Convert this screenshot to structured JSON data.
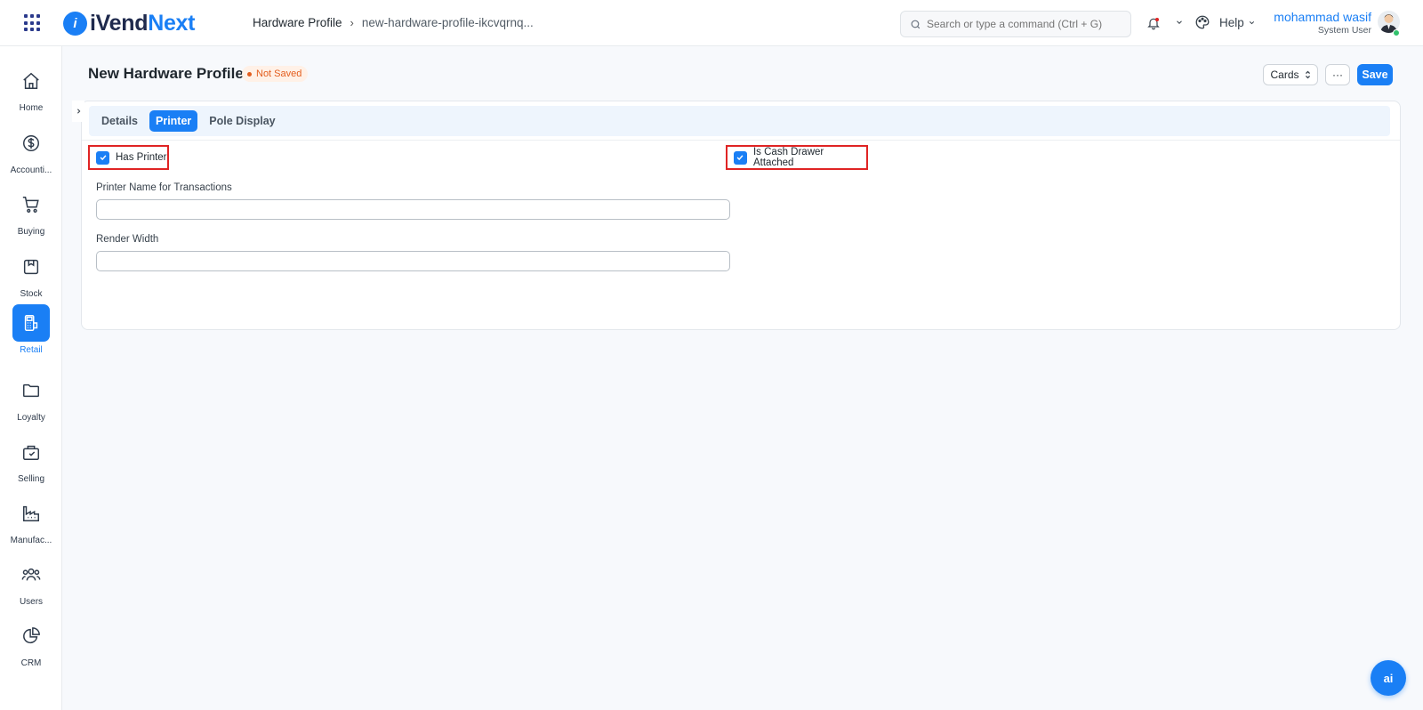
{
  "app": {
    "logo_prefix": "iVend",
    "logo_suffix": "Next"
  },
  "breadcrumb": {
    "parent": "Hardware Profile",
    "separator": "›",
    "current": "new-hardware-profile-ikcvqrnq..."
  },
  "search": {
    "placeholder": "Search or type a command (Ctrl + G)"
  },
  "header": {
    "help_label": "Help"
  },
  "user": {
    "name": "mohammad wasif",
    "role": "System User"
  },
  "sidebar": {
    "items": [
      {
        "label": "Home",
        "icon": "home-icon"
      },
      {
        "label": "Accounti...",
        "icon": "dollar-icon"
      },
      {
        "label": "Buying",
        "icon": "cart-icon"
      },
      {
        "label": "Stock",
        "icon": "box-icon"
      },
      {
        "label": "Retail",
        "icon": "pos-icon"
      },
      {
        "label": "Loyalty",
        "icon": "folder-icon"
      },
      {
        "label": "Selling",
        "icon": "shopping-bag-icon"
      },
      {
        "label": "Manufac...",
        "icon": "factory-icon"
      },
      {
        "label": "Users",
        "icon": "users-icon"
      },
      {
        "label": "CRM",
        "icon": "pie-chart-icon"
      }
    ],
    "active_index": 4
  },
  "page": {
    "title": "New Hardware Profile",
    "status": "Not Saved",
    "cards_label": "Cards",
    "more_label": "···",
    "save_label": "Save"
  },
  "tabs": [
    {
      "label": "Details",
      "active": false
    },
    {
      "label": "Printer",
      "active": true
    },
    {
      "label": "Pole Display",
      "active": false
    }
  ],
  "form": {
    "has_printer": {
      "label": "Has Printer",
      "checked": true
    },
    "cash_drawer": {
      "label": "Is Cash Drawer Attached",
      "checked": true
    },
    "printer_name": {
      "label": "Printer Name for Transactions",
      "value": ""
    },
    "render_width": {
      "label": "Render Width",
      "value": ""
    }
  },
  "fab": {
    "label": "ai"
  },
  "colors": {
    "accent": "#1a7ff5",
    "highlight": "#e02424",
    "status": "#e35d1d"
  }
}
